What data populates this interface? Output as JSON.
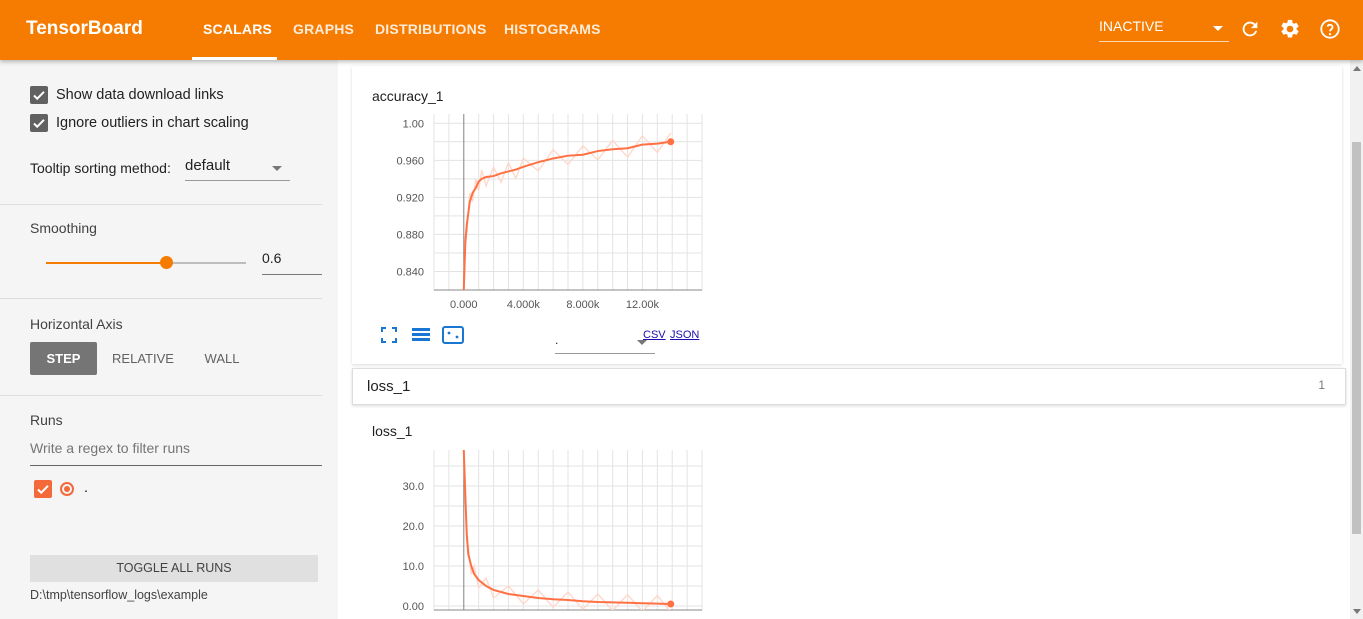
{
  "app": {
    "title": "TensorBoard"
  },
  "tabs": [
    {
      "label": "SCALARS",
      "active": true
    },
    {
      "label": "GRAPHS"
    },
    {
      "label": "DISTRIBUTIONS"
    },
    {
      "label": "HISTOGRAMS"
    }
  ],
  "header": {
    "status_selected": "INACTIVE",
    "icons": [
      "refresh-icon",
      "settings-icon",
      "help-icon"
    ]
  },
  "sidebar": {
    "show_download_links": {
      "label": "Show data download links",
      "checked": true
    },
    "ignore_outliers": {
      "label": "Ignore outliers in chart scaling",
      "checked": true
    },
    "tooltip_sorting": {
      "label": "Tooltip sorting method:",
      "value": "default"
    },
    "smoothing": {
      "label": "Smoothing",
      "value": "0.6",
      "fraction": 0.6
    },
    "horizontal_axis": {
      "label": "Horizontal Axis",
      "options": [
        "STEP",
        "RELATIVE",
        "WALL"
      ],
      "selected": "STEP"
    },
    "runs": {
      "label": "Runs",
      "filter_placeholder": "Write a regex to filter runs",
      "items": [
        {
          "name": ".",
          "checked": true,
          "color": "#f4693a"
        }
      ]
    },
    "toggle_all_label": "TOGGLE ALL RUNS",
    "logdir": "D:\\tmp\\tensorflow_logs\\example"
  },
  "cards": {
    "accuracy": {
      "title": "accuracy_1",
      "run_select_value": ".",
      "csv_label": "CSV",
      "json_label": "JSON",
      "icons": [
        "expand-icon",
        "data-table-icon",
        "fit-domain-icon"
      ]
    },
    "loss_group": {
      "title": "loss_1",
      "count": "1"
    },
    "loss": {
      "title": "loss_1"
    }
  },
  "colors": {
    "accent": "#f57c00",
    "run_line": "#ff7043",
    "run_raw": "#ffd8cc"
  },
  "chart_data": [
    {
      "type": "line",
      "title": "accuracy_1",
      "y_tick_labels": [
        "0.840",
        "0.880",
        "0.920",
        "0.960",
        "1.00"
      ],
      "y_ticks": [
        0.84,
        0.88,
        0.92,
        0.96,
        1.0
      ],
      "x_tick_labels": [
        "0.000",
        "4.000k",
        "8.000k",
        "12.00k"
      ],
      "x_ticks": [
        0,
        4000,
        8000,
        12000
      ],
      "xlim": [
        -2000,
        16000
      ],
      "ylim": [
        0.82,
        1.01
      ],
      "grid": true,
      "series": [
        {
          "kind": "smoothed",
          "x": [
            0,
            100,
            200,
            400,
            600,
            800,
            1000,
            1200,
            1500,
            2000,
            2500,
            3000,
            3500,
            4000,
            5000,
            6000,
            7000,
            8000,
            9000,
            10000,
            11000,
            12000,
            13000,
            13900
          ],
          "y": [
            0.82,
            0.87,
            0.89,
            0.915,
            0.925,
            0.93,
            0.937,
            0.94,
            0.942,
            0.943,
            0.946,
            0.948,
            0.95,
            0.953,
            0.958,
            0.962,
            0.965,
            0.966,
            0.97,
            0.972,
            0.973,
            0.977,
            0.978,
            0.98
          ]
        }
      ]
    },
    {
      "type": "line",
      "title": "loss_1",
      "y_tick_labels": [
        "0.00",
        "10.0",
        "20.0",
        "30.0"
      ],
      "y_ticks": [
        0,
        10,
        20,
        30
      ],
      "xlim": [
        -2000,
        16000
      ],
      "ylim": [
        -1,
        39
      ],
      "grid": true,
      "series": [
        {
          "kind": "smoothed",
          "x": [
            0,
            100,
            200,
            300,
            500,
            700,
            1000,
            1500,
            2000,
            3000,
            4000,
            5000,
            6000,
            7000,
            8000,
            9000,
            10000,
            11000,
            12000,
            13000,
            13900
          ],
          "y": [
            39,
            28,
            18,
            13,
            10,
            8,
            6.5,
            5,
            4,
            3,
            2.5,
            2,
            1.7,
            1.5,
            1.2,
            1.0,
            0.9,
            0.8,
            0.7,
            0.6,
            0.5
          ]
        }
      ]
    }
  ]
}
